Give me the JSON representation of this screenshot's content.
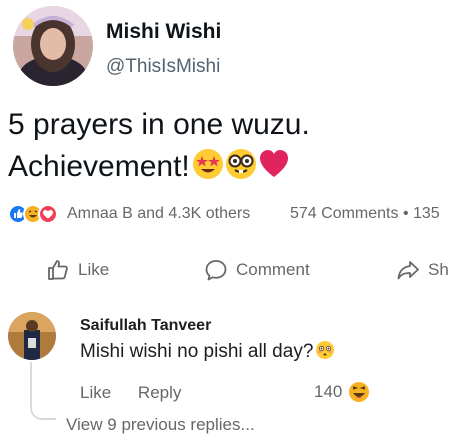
{
  "tweet": {
    "author_name": "Mishi Wishi",
    "handle": "@ThisIsMishi",
    "text_line1": "5 prayers in one wuzu.",
    "text_line2": "Achievement!",
    "emojis": [
      "star-struck-emoji",
      "nerd-face-emoji",
      "red-heart-emoji"
    ]
  },
  "reactions": {
    "icons": [
      "like-reaction-icon",
      "haha-reaction-icon",
      "love-reaction-icon"
    ],
    "summary": "Amnaa B and 4.3K others",
    "comments": "574 Comments • 135"
  },
  "actions": {
    "like": "Like",
    "comment": "Comment",
    "share": "Sh"
  },
  "comment": {
    "author": "Saifullah Tanveer",
    "text": "Mishi wishi no pishi all day?",
    "like": "Like",
    "reply": "Reply",
    "reaction_count": "140",
    "view_replies": "View 9 previous replies..."
  },
  "colors": {
    "like_blue": "#1877f2",
    "love_red": "#f33e58",
    "haha_yellow": "#f7b125",
    "heart": "#e0245e"
  }
}
